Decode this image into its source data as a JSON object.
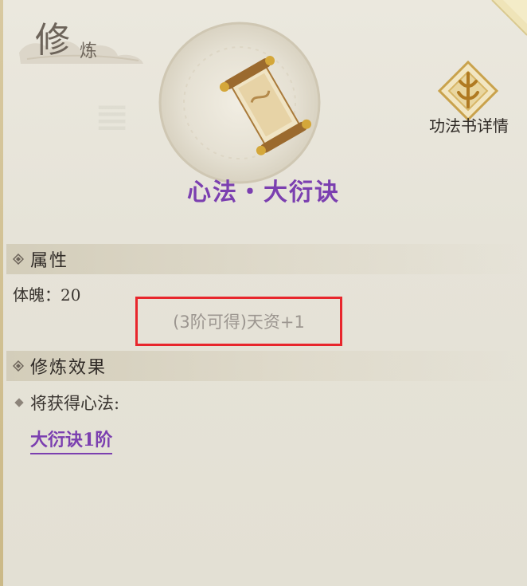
{
  "header": {
    "title_big": "修",
    "title_small": "炼"
  },
  "skill": {
    "name": "心法・大衍诀",
    "icon": "scroll-icon"
  },
  "book_detail": {
    "label": "功法书详情",
    "icon": "emblem-icon"
  },
  "attributes": {
    "section_label": "属性",
    "stat_line": "体魄：20",
    "unlock_note": "(3阶可得)天资+1"
  },
  "effects": {
    "section_label": "修炼效果",
    "gain_label": "将获得心法:",
    "skill_link": "大衍诀1阶"
  },
  "colors": {
    "accent_purple": "#7b3fb0",
    "highlight_red": "#e8262c",
    "muted_text": "#9c9690"
  }
}
